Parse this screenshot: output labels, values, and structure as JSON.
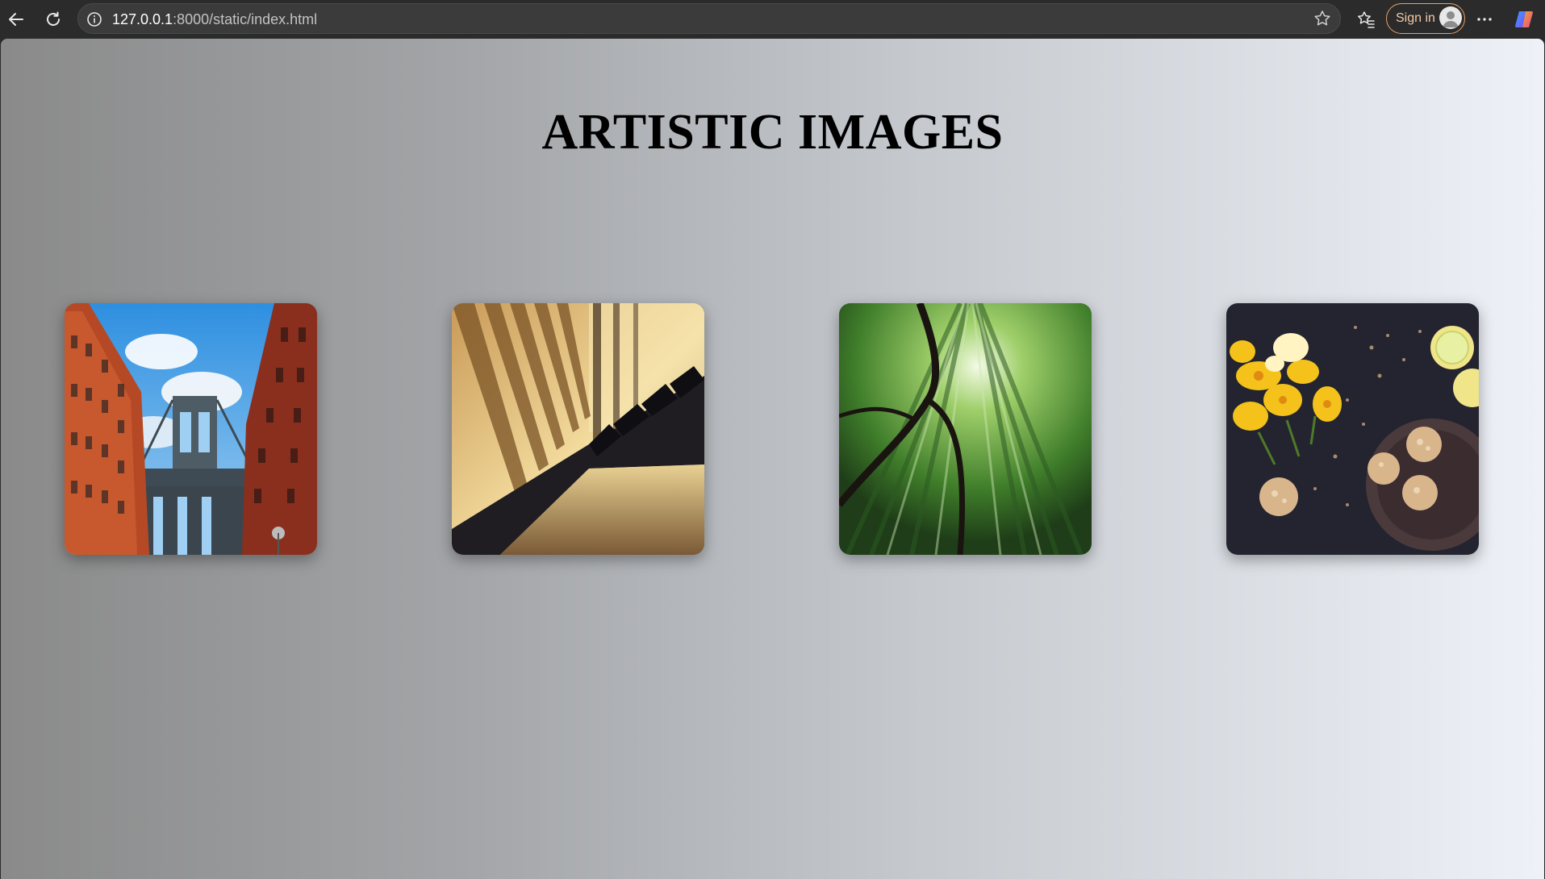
{
  "browser": {
    "url_host": "127.0.0.1",
    "url_path": ":8000/static/index.html",
    "sign_in_label": "Sign in",
    "icons": [
      "back-icon",
      "reload-icon",
      "info-icon",
      "star-icon",
      "favorites-icon",
      "more-icon",
      "copilot-icon"
    ]
  },
  "page": {
    "title": "ARTISTIC IMAGES",
    "images": [
      {
        "subject": "bridge-street"
      },
      {
        "subject": "piano-keys"
      },
      {
        "subject": "bamboo-forest"
      },
      {
        "subject": "flowers-cookies"
      }
    ]
  }
}
